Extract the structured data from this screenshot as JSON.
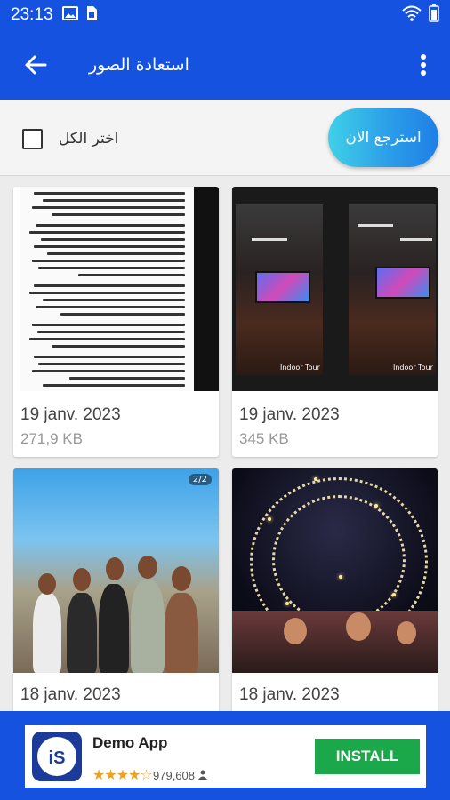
{
  "status_bar": {
    "time": "23:13",
    "left_icons": [
      "image-icon",
      "sim-icon"
    ],
    "right_icons": [
      "wifi-icon",
      "battery-icon"
    ]
  },
  "app_bar": {
    "title": "استعادة الصور",
    "back_icon": "arrow-back-icon",
    "menu_icon": "more-vert-icon"
  },
  "toolbar": {
    "select_all_label": "اختر الكل",
    "restore_button_label": "استرجع الان",
    "select_all_checked": false
  },
  "photos": [
    {
      "date": "19 janv. 2023",
      "size": "271,9 KB",
      "thumbnail": "document-screenshot"
    },
    {
      "date": "19 janv. 2023",
      "size": "345 KB",
      "thumbnail": "desk-setup"
    },
    {
      "date": "18 janv. 2023",
      "size": "",
      "thumbnail": "group-beach-photo",
      "badge": "2/2"
    },
    {
      "date": "18 janv. 2023",
      "size": "",
      "thumbnail": "night-ferris-wheel"
    }
  ],
  "ad": {
    "app_name": "Demo App",
    "rating_stars": "★★★★☆",
    "rating_value": 4.5,
    "rating_count": "979,608",
    "install_label": "INSTALL",
    "logo_text": "iS"
  },
  "colors": {
    "primary": "#1652e0",
    "install_green": "#1aa84a",
    "star": "#f0a020"
  }
}
